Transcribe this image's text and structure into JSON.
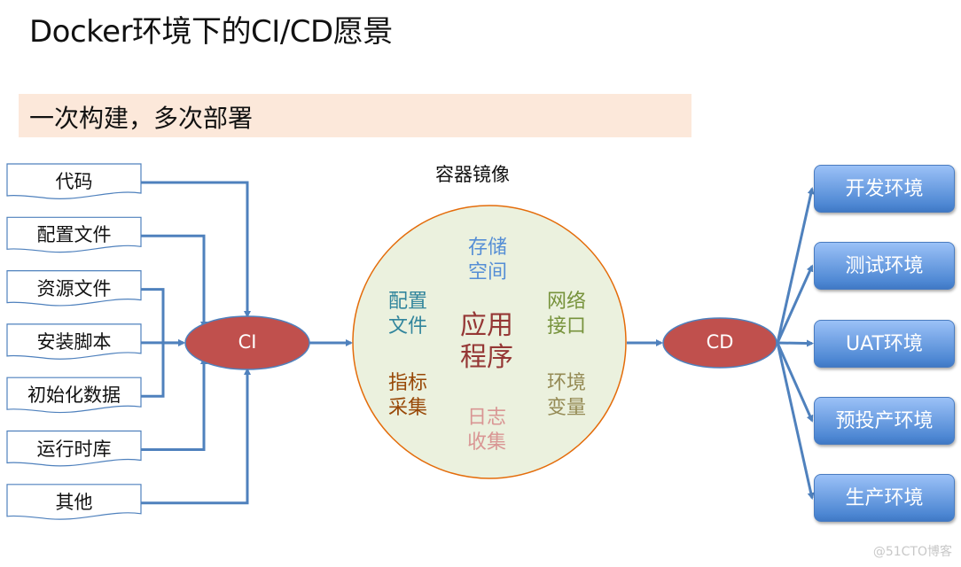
{
  "title": "Docker环境下的CI/CD愿景",
  "banner": "一次构建，多次部署",
  "image_label": "容器镜像",
  "inputs": [
    "代码",
    "配置文件",
    "资源文件",
    "安装脚本",
    "初始化数据",
    "运行时库",
    "其他"
  ],
  "ci_label": "CI",
  "cd_label": "CD",
  "image_contents": {
    "center": [
      "应用",
      "程序"
    ],
    "top": [
      "存储",
      "空间"
    ],
    "left_top": [
      "配置",
      "文件"
    ],
    "right_top": [
      "网络",
      "接口"
    ],
    "left_bottom": [
      "指标",
      "采集"
    ],
    "right_bottom": [
      "环境",
      "变量"
    ],
    "bottom": [
      "日志",
      "收集"
    ]
  },
  "environments": [
    "开发环境",
    "测试环境",
    "UAT环境",
    "预投产环境",
    "生产环境"
  ],
  "colors": {
    "arrow": "#4f81bd",
    "ellipse_fill": "#c0504d",
    "circle_fill": "#ebf1de",
    "circle_stroke": "#e46c0a",
    "banner": "#fce8da",
    "center_text": "#953735",
    "top_text": "#558ed5",
    "left_top_text": "#31859c",
    "right_top_text": "#77933c",
    "left_bottom_text": "#984807",
    "right_bottom_text": "#948a54",
    "bottom_text": "#d99694"
  },
  "watermark": "@51CTO博客"
}
